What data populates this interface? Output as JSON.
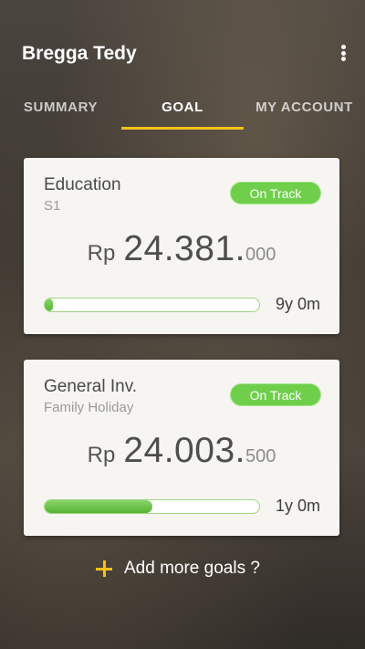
{
  "app": {
    "title": "Bregga Tedy",
    "menu_icon": "more-vertical-icon"
  },
  "tabs": [
    {
      "label": "SUMMARY",
      "active": false
    },
    {
      "label": "GOAL",
      "active": true
    },
    {
      "label": "MY ACCOUNT",
      "active": false
    }
  ],
  "colors": {
    "accent": "#f2c21b",
    "on_track": "#6fcf4b",
    "progress": "#56b432"
  },
  "goals": [
    {
      "name": "Education",
      "subtitle": "S1",
      "status": "On Track",
      "currency": "Rp",
      "amount_main": "24.381.",
      "amount_decimal": "000",
      "progress_fraction": 0.04,
      "duration": "9y 0m"
    },
    {
      "name": "General Inv.",
      "subtitle": "Family Holiday",
      "status": "On Track",
      "currency": "Rp",
      "amount_main": "24.003.",
      "amount_decimal": "500",
      "progress_fraction": 0.5,
      "duration": "1y 0m"
    }
  ],
  "add_goal": {
    "label": "Add more goals ?",
    "icon": "plus-icon"
  }
}
